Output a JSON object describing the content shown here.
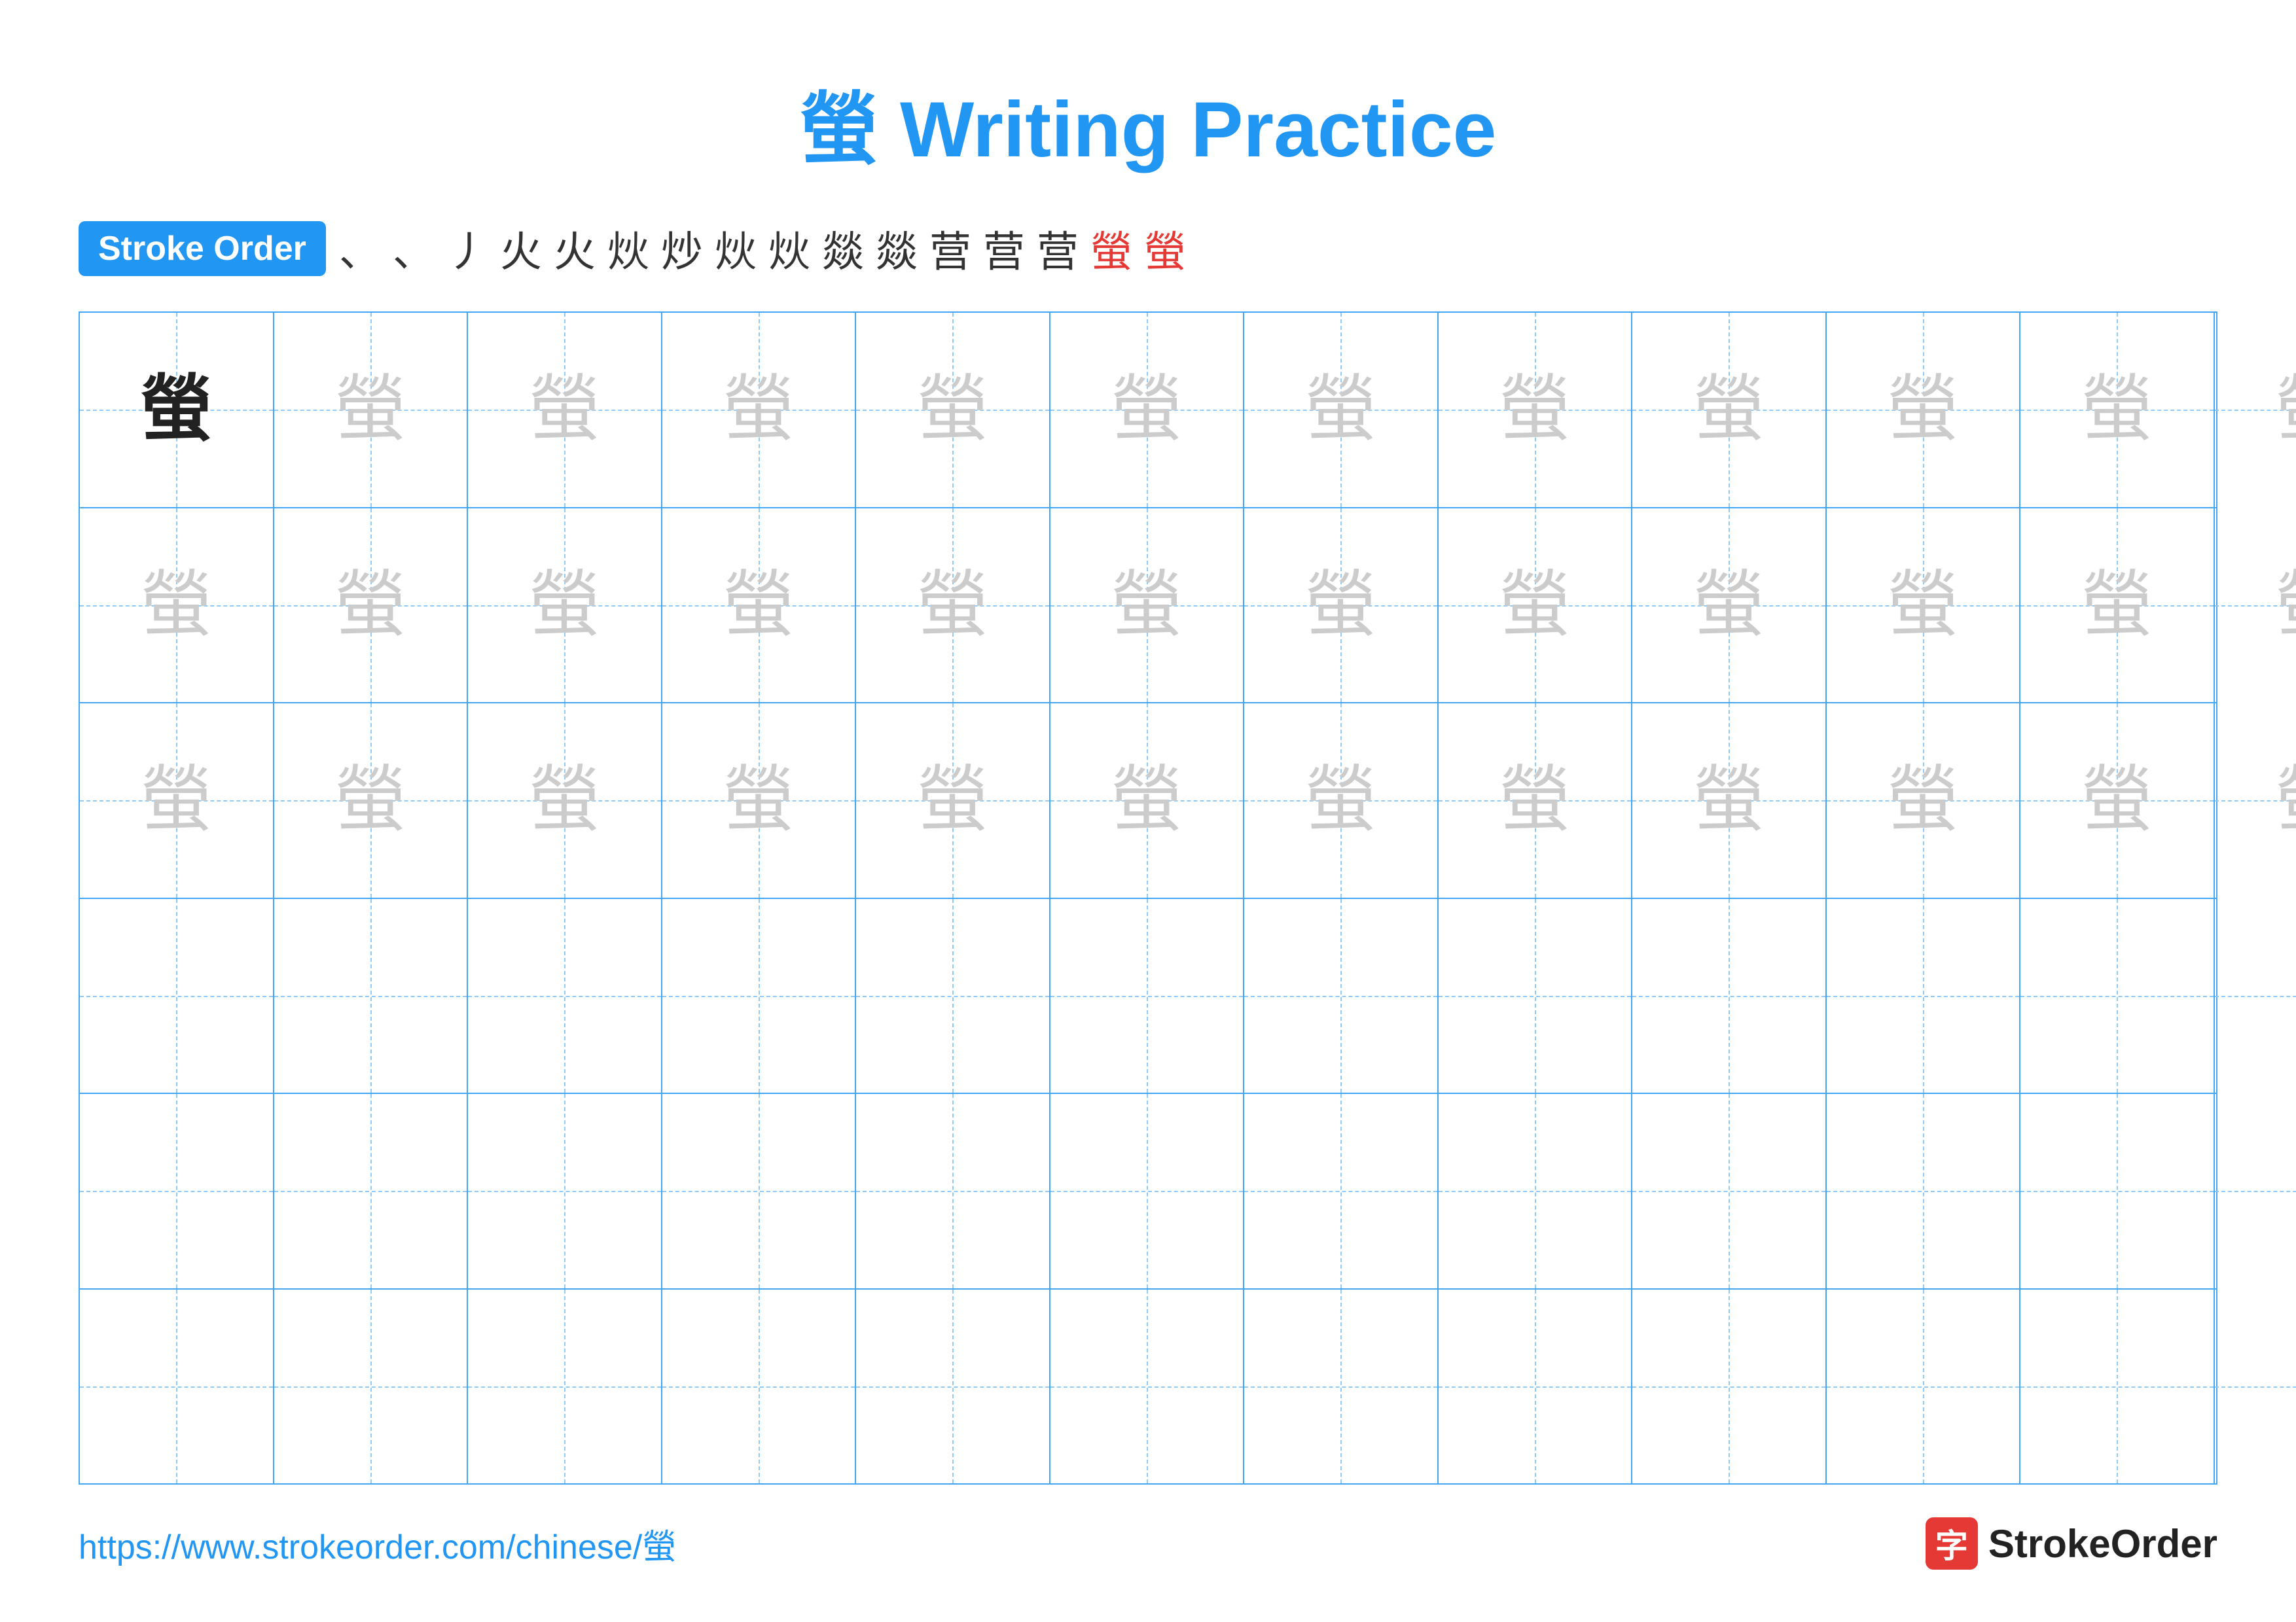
{
  "title": "螢 Writing Practice",
  "stroke_order_badge": "Stroke Order",
  "stroke_sequence": [
    "、",
    "、",
    "丿",
    "火",
    "火",
    "炏",
    "炒",
    "炏",
    "炏",
    "燚",
    "燚",
    "营",
    "营",
    "营",
    "螢",
    "螢"
  ],
  "stroke_sequence_red_from": 14,
  "character": "螢",
  "grid": {
    "cols": 13,
    "rows": 6,
    "filled_rows": [
      {
        "type": "dark_then_light",
        "dark_count": 1,
        "light_count": 12
      },
      {
        "type": "light",
        "count": 13
      },
      {
        "type": "light",
        "count": 13
      },
      {
        "type": "empty"
      },
      {
        "type": "empty"
      },
      {
        "type": "empty"
      }
    ]
  },
  "footer": {
    "url": "https://www.strokeorder.com/chinese/螢",
    "logo_char": "字",
    "logo_text": "StrokeOrder"
  }
}
